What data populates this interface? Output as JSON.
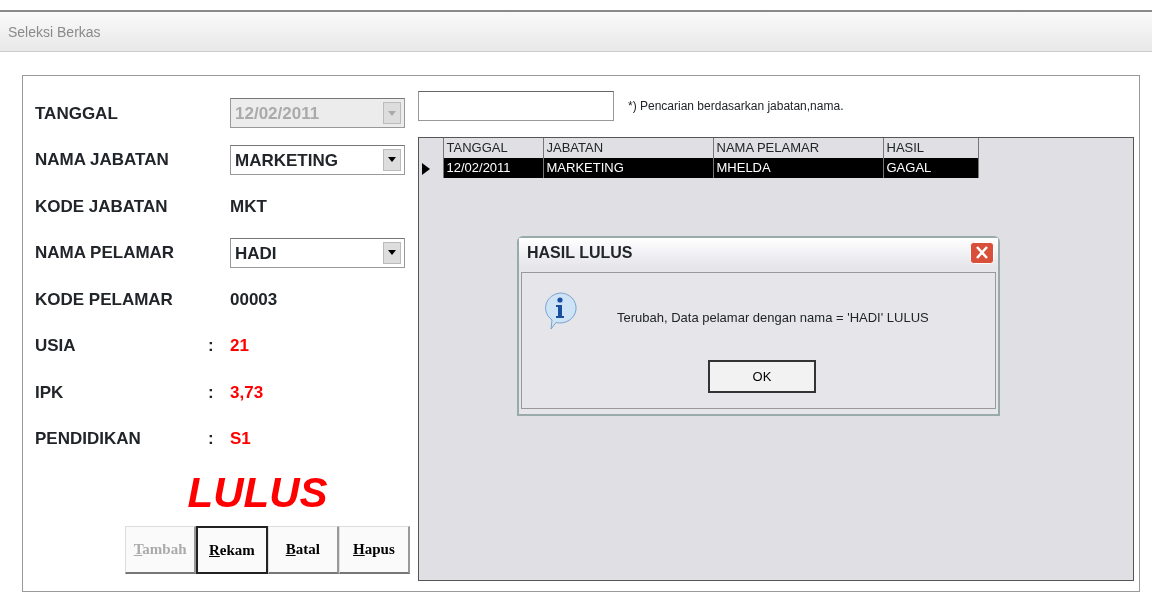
{
  "window": {
    "title": "Seleksi Berkas"
  },
  "form": {
    "fields": [
      {
        "label": "TANGGAL",
        "kind": "combo",
        "value": "12/02/2011",
        "disabled": true
      },
      {
        "label": "NAMA JABATAN",
        "kind": "combo",
        "value": "MARKETING",
        "disabled": false
      },
      {
        "label": "KODE JABATAN",
        "kind": "value",
        "value": "MKT"
      },
      {
        "label": "NAMA PELAMAR",
        "kind": "combo",
        "value": "HADI",
        "disabled": false
      },
      {
        "label": "KODE PELAMAR",
        "kind": "value",
        "value": "00003"
      },
      {
        "label": "USIA",
        "kind": "colon",
        "separator": ":",
        "value": "21"
      },
      {
        "label": "IPK",
        "kind": "colon",
        "separator": ":",
        "value": "3,73"
      },
      {
        "label": "PENDIDIKAN",
        "kind": "colon",
        "separator": ":",
        "value": "S1"
      }
    ],
    "result": "LULUS",
    "buttons": [
      {
        "label": "Tambah",
        "disabled": true,
        "selected": false
      },
      {
        "label": "Rekam",
        "disabled": false,
        "selected": true
      },
      {
        "label": "Batal",
        "disabled": false,
        "selected": false
      },
      {
        "label": "Hapus",
        "disabled": false,
        "selected": false
      }
    ]
  },
  "search": {
    "hint": "*) Pencarian berdasarkan jabatan,nama."
  },
  "table": {
    "columns": [
      "TANGGAL",
      "JABATAN",
      "NAMA PELAMAR",
      "HASIL"
    ],
    "rows": [
      {
        "cells": [
          "12/02/2011",
          "MARKETING",
          "MHELDA",
          "GAGAL"
        ],
        "selected": true
      }
    ]
  },
  "dialog": {
    "title": "HASIL LULUS",
    "message": "Terubah, Data pelamar dengan nama = 'HADI' LULUS",
    "button": "OK"
  }
}
